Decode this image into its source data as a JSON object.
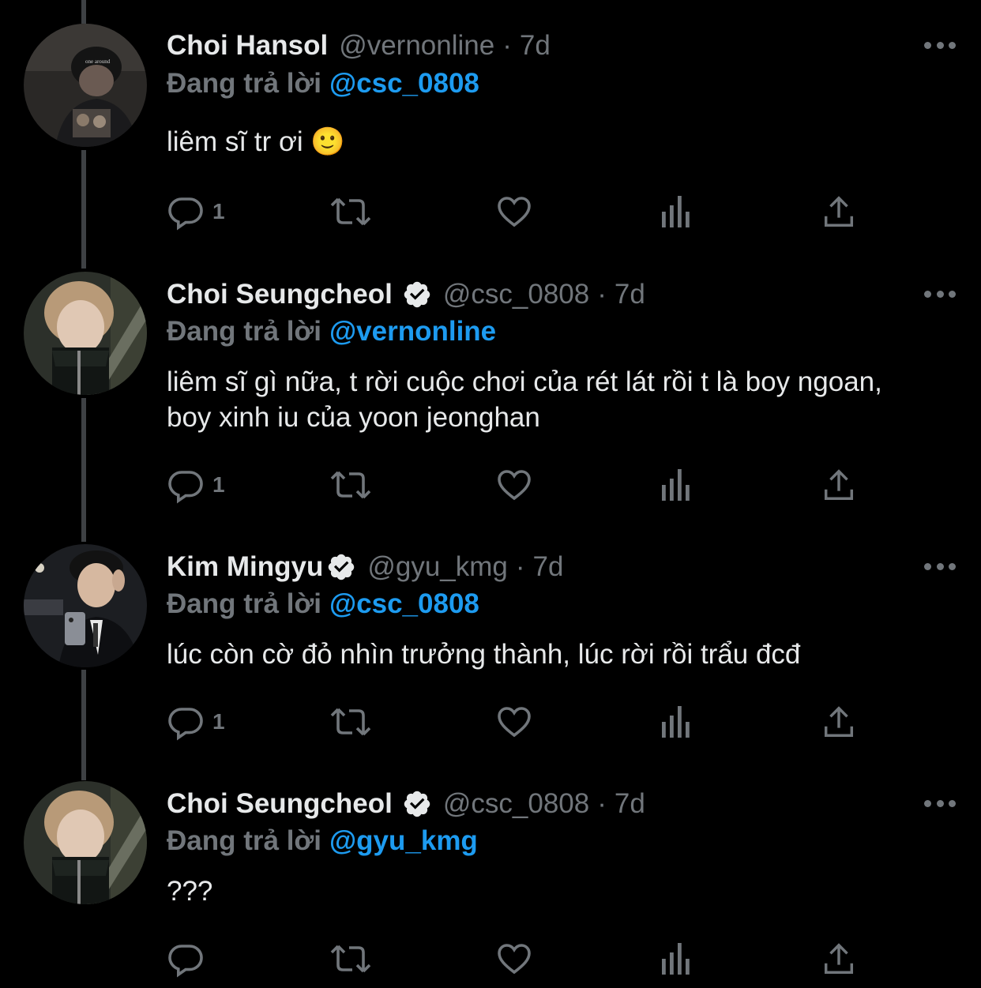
{
  "tweets": [
    {
      "name": "Choi Hansol",
      "verified": false,
      "handle": "@vernonline",
      "time": "7d",
      "replying_label": "Đang trả lời",
      "replying_to": "@csc_0808",
      "text": "liêm sĩ tr ơi 🙂",
      "reply_count": "1"
    },
    {
      "name": "Choi Seungcheol",
      "verified": true,
      "handle": "@csc_0808",
      "time": "7d",
      "replying_label": "Đang trả lời",
      "replying_to": "@vernonline",
      "text": "liêm sĩ gì nữa, t rời cuộc chơi của rét lát rồi t là boy ngoan, boy xinh iu của yoon jeonghan",
      "reply_count": "1"
    },
    {
      "name": "Kim Mingyu",
      "verified": true,
      "handle": "@gyu_kmg",
      "time": "7d",
      "replying_label": "Đang trả lời",
      "replying_to": "@csc_0808",
      "text": "lúc còn cờ đỏ nhìn trưởng thành, lúc rời rồi trẩu đcđ",
      "reply_count": "1"
    },
    {
      "name": "Choi Seungcheol",
      "verified": true,
      "handle": "@csc_0808",
      "time": "7d",
      "replying_label": "Đang trả lời",
      "replying_to": "@gyu_kmg",
      "text": "???",
      "reply_count": ""
    }
  ],
  "separator": "·",
  "icons": [
    "reply-icon",
    "retweet-icon",
    "like-icon",
    "views-icon",
    "share-icon",
    "more-icon",
    "verified-badge-icon"
  ],
  "colors": {
    "background": "#000000",
    "text": "#E7E9EA",
    "muted": "#71767B",
    "mention": "#1D9BF0",
    "thread_line": "#3E4144"
  }
}
